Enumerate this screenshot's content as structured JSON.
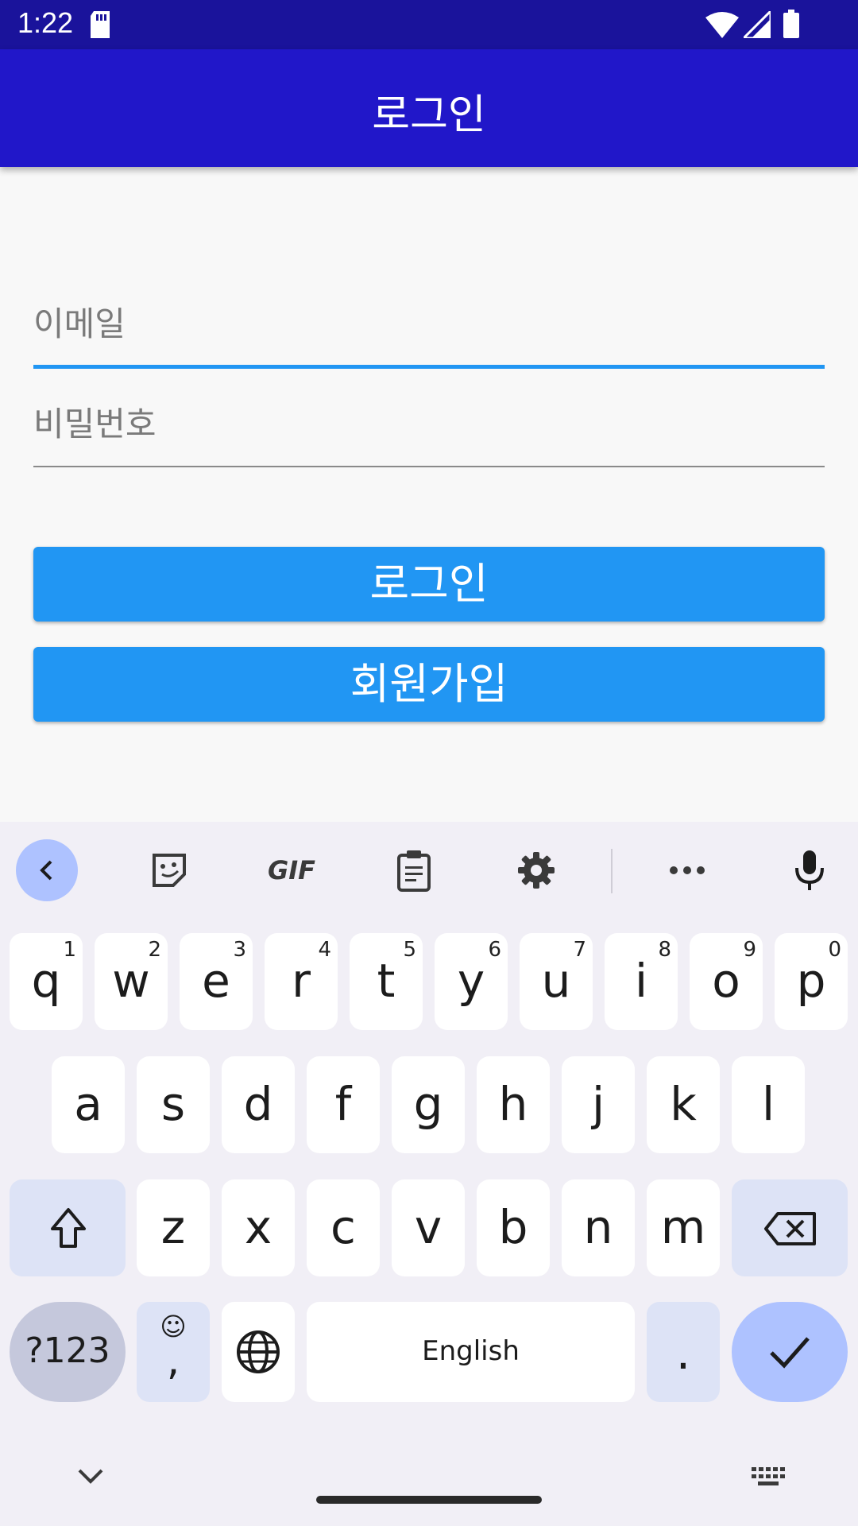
{
  "status_bar": {
    "time": "1:22",
    "icons": [
      "sd-card-icon",
      "wifi-icon",
      "signal-icon",
      "battery-icon"
    ]
  },
  "app_bar": {
    "title": "로그인"
  },
  "form": {
    "email": {
      "placeholder": "이메일",
      "value": ""
    },
    "password": {
      "placeholder": "비밀번호",
      "value": ""
    },
    "login_button": "로그인",
    "signup_button": "회원가입"
  },
  "keyboard": {
    "toolbar": {
      "gif_label": "GIF",
      "icons": [
        "back-icon",
        "sticker-icon",
        "gif-icon",
        "clipboard-icon",
        "gear-icon",
        "more-icon",
        "mic-icon"
      ]
    },
    "row1": [
      {
        "ch": "q",
        "hint": "1"
      },
      {
        "ch": "w",
        "hint": "2"
      },
      {
        "ch": "e",
        "hint": "3"
      },
      {
        "ch": "r",
        "hint": "4"
      },
      {
        "ch": "t",
        "hint": "5"
      },
      {
        "ch": "y",
        "hint": "6"
      },
      {
        "ch": "u",
        "hint": "7"
      },
      {
        "ch": "i",
        "hint": "8"
      },
      {
        "ch": "o",
        "hint": "9"
      },
      {
        "ch": "p",
        "hint": "0"
      }
    ],
    "row2": [
      "a",
      "s",
      "d",
      "f",
      "g",
      "h",
      "j",
      "k",
      "l"
    ],
    "row3": [
      "z",
      "x",
      "c",
      "v",
      "b",
      "n",
      "m"
    ],
    "row4": {
      "symbols": "?123",
      "emoji_comma": ",",
      "space": "English",
      "period": "."
    }
  },
  "colors": {
    "status_bar": "#1a139b",
    "app_bar": "#2117c9",
    "accent": "#2196f3"
  }
}
